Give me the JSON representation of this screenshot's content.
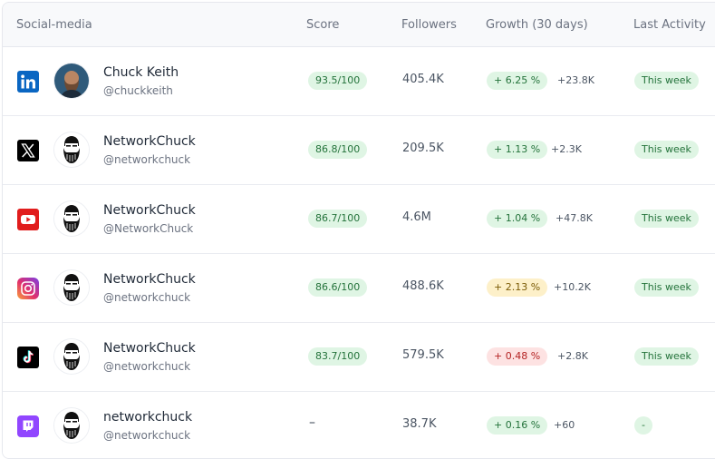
{
  "columns": {
    "social": "Social-media",
    "score": "Score",
    "followers": "Followers",
    "growth": "Growth (30 days)",
    "activity": "Last Activity"
  },
  "rows": [
    {
      "platform": "linkedin-icon",
      "avatar": "photo-avatar",
      "name": "Chuck Keith",
      "handle": "@chuckkeith",
      "score": "93.5/100",
      "followers": "405.4K",
      "growth": "+ 6.25 %",
      "growth_status": "green",
      "delta": "+23.8K",
      "activity": "This week"
    },
    {
      "platform": "x-icon",
      "avatar": "bearded-logo-avatar",
      "name": "NetworkChuck",
      "handle": "@networkchuck",
      "score": "86.8/100",
      "followers": "209.5K",
      "growth": "+ 1.13 %",
      "growth_status": "green",
      "delta": "+2.3K",
      "activity": "This week"
    },
    {
      "platform": "youtube-icon",
      "avatar": "bearded-logo-avatar",
      "name": "NetworkChuck",
      "handle": "@NetworkChuck",
      "score": "86.7/100",
      "followers": "4.6M",
      "growth": "+ 1.04 %",
      "growth_status": "green",
      "delta": "+47.8K",
      "activity": "This week"
    },
    {
      "platform": "instagram-icon",
      "avatar": "bearded-logo-avatar",
      "name": "NetworkChuck",
      "handle": "@networkchuck",
      "score": "86.6/100",
      "followers": "488.6K",
      "growth": "+ 2.13 %",
      "growth_status": "yellow",
      "delta": "+10.2K",
      "activity": "This week"
    },
    {
      "platform": "tiktok-icon",
      "avatar": "bearded-logo-avatar",
      "name": "NetworkChuck",
      "handle": "@networkchuck",
      "score": "83.7/100",
      "followers": "579.5K",
      "growth": "+ 0.48 %",
      "growth_status": "red",
      "delta": "+2.8K",
      "activity": "This week"
    },
    {
      "platform": "twitch-icon",
      "avatar": "bearded-logo-avatar",
      "name": "networkchuck",
      "handle": "@networkchuck",
      "score": "–",
      "followers": "38.7K",
      "growth": "+ 0.16 %",
      "growth_status": "green",
      "delta": "+60",
      "activity": "-"
    }
  ]
}
